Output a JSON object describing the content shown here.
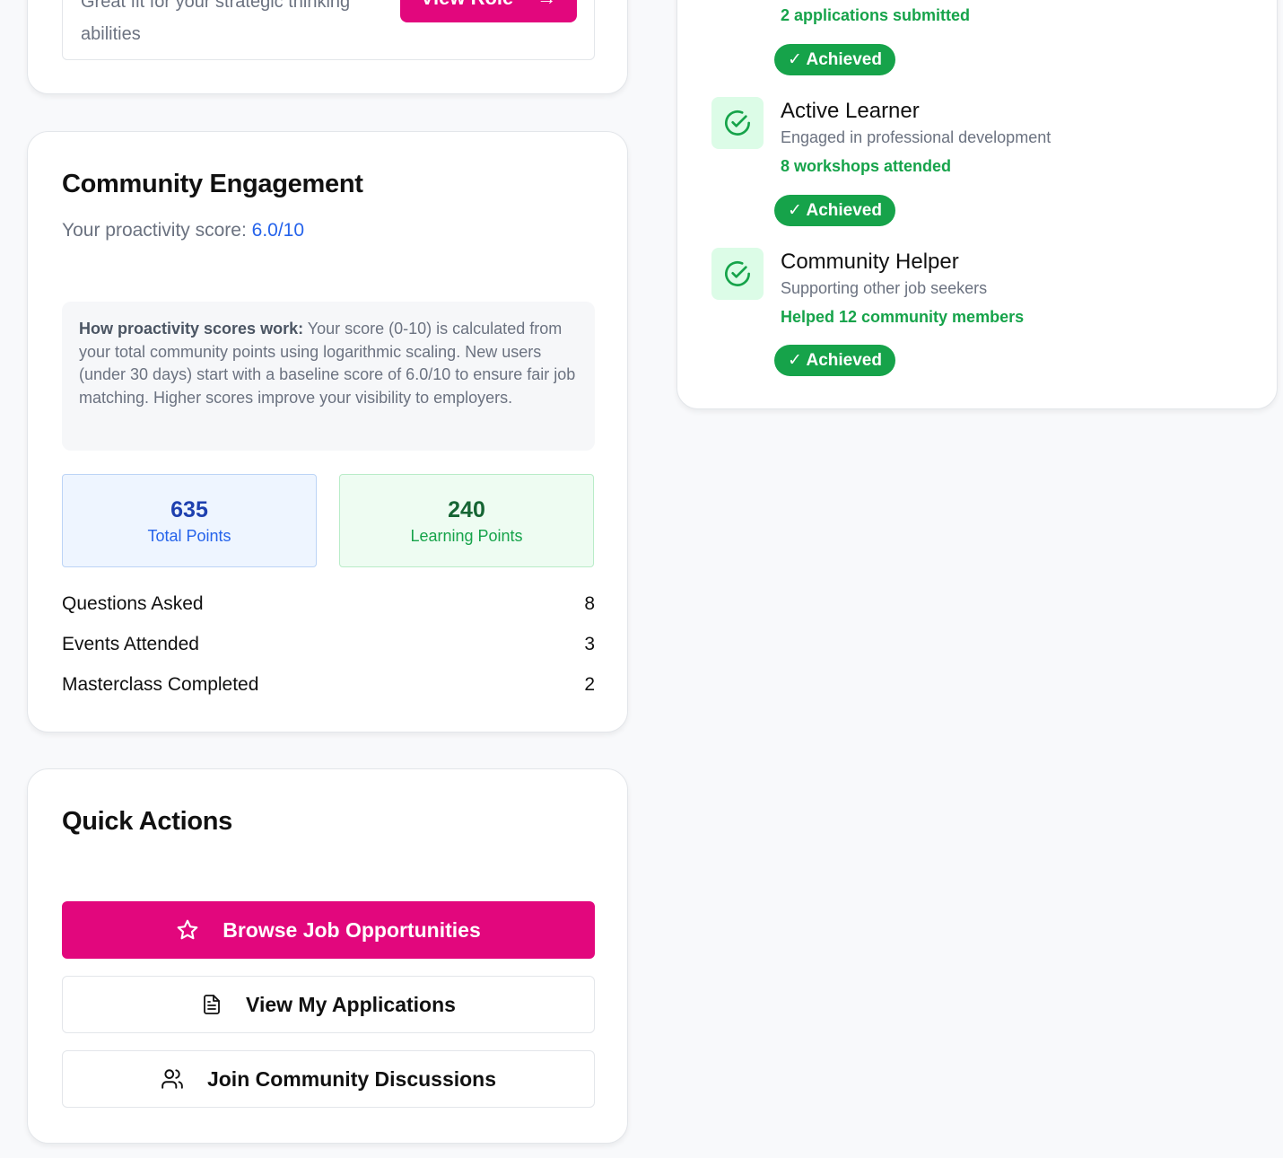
{
  "top_card": {
    "role_text": "Great fit for your strategic thinking abilities",
    "view_role_label": "View Role",
    "arrow": "→"
  },
  "engagement": {
    "title": "Community Engagement",
    "score_label": "Your proactivity score: ",
    "score_value": "6.0/10",
    "info_bold": "How proactivity scores work:",
    "info_text": " Your score (0-10) is calculated from your total community points using logarithmic scaling. New users (under 30 days) start with a baseline score of 6.0/10 to ensure fair job matching. Higher scores improve your visibility to employers.",
    "total_points_value": "635",
    "total_points_label": "Total Points",
    "learning_points_value": "240",
    "learning_points_label": "Learning Points",
    "stats": [
      {
        "label": "Questions Asked",
        "value": "8"
      },
      {
        "label": "Events Attended",
        "value": "3"
      },
      {
        "label": "Masterclass Completed",
        "value": "2"
      }
    ]
  },
  "quick_actions": {
    "title": "Quick Actions",
    "browse_label": "Browse Job Opportunities",
    "applications_label": "View My Applications",
    "community_label": "Join Community Discussions",
    "icons": [
      "star-icon",
      "document-icon",
      "users-icon"
    ]
  },
  "achievements": {
    "items": [
      {
        "metric": "2 applications submitted",
        "badge": "✓ Achieved"
      },
      {
        "title": "Active Learner",
        "desc": "Engaged in professional development",
        "metric": "8 workshops attended",
        "badge": "✓ Achieved"
      },
      {
        "title": "Community Helper",
        "desc": "Supporting other job seekers",
        "metric": "Helped 12 community members",
        "badge": "✓ Achieved"
      }
    ]
  },
  "colors": {
    "brand_pink": "#e2077d",
    "success_green": "#16a34a",
    "link_blue": "#2563eb"
  }
}
